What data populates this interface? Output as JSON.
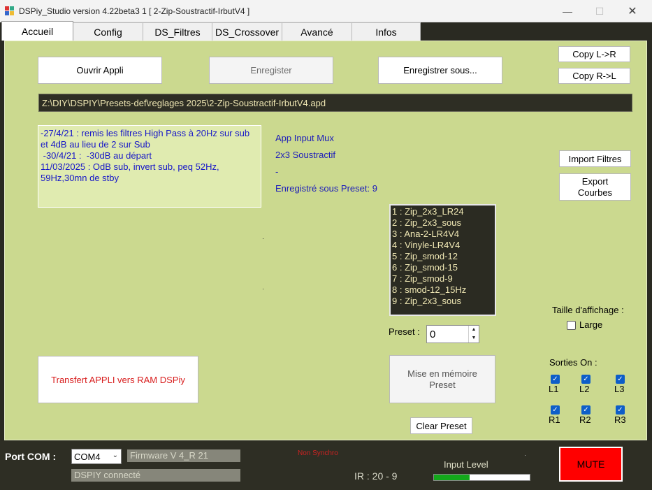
{
  "window": {
    "title": "DSPiy_Studio version 4.22beta3 1 [ 2-Zip-Soustractif-IrbutV4 ]",
    "minimize_icon": "minimize-icon",
    "maximize_icon": "maximize-icon",
    "close_icon": "close-icon"
  },
  "tabs": [
    {
      "label": "Accueil"
    },
    {
      "label": "Config"
    },
    {
      "label": "DS_Filtres"
    },
    {
      "label": "DS_Crossover"
    },
    {
      "label": "Avancé"
    },
    {
      "label": "Infos"
    }
  ],
  "toolbar": {
    "open_label": "Ouvrir Appli",
    "save_label": "Enregister",
    "save_as_label": "Enregistrer sous...",
    "copy_lr_label": "Copy L->R",
    "copy_rl_label": "Copy R->L"
  },
  "file_path": "Z:\\DIY\\DSPIY\\Presets-def\\reglages 2025\\2-Zip-Soustractif-IrbutV4.apd",
  "notes": {
    "lines": [
      "-27/4/21 : remis les filtres High Pass à 20Hz sur sub et 4dB au lieu de 2 sur Sub",
      " -30/4/21 :  -30dB au départ",
      "11/03/2025 : OdB sub, invert sub, peq 52Hz, 59Hz,30mn de stby"
    ]
  },
  "app_info": {
    "line1": "App Input Mux",
    "line2": "2x3 Soustractif",
    "line3": "-",
    "line4": "Enregistré sous Preset: 9"
  },
  "side_buttons": {
    "import_label": "Import Filtres",
    "export_label": "Export\nCourbes"
  },
  "presets": [
    "1 : Zip_2x3_LR24",
    "2 : Zip_2x3_sous",
    "3 : Ana-2-LR4V4",
    "4 : Vinyle-LR4V4",
    "5 : Zip_smod-12",
    "6 : Zip_smod-15",
    "7 : Zip_smod-9",
    "8 : smod-12_15Hz",
    "9 : Zip_2x3_sous"
  ],
  "preset_selector": {
    "label": "Preset :",
    "value": "0",
    "up_icon": "arrow-up-icon",
    "down_icon": "arrow-down-icon"
  },
  "display": {
    "size_label": "Taille d'affichage :",
    "large_label": "Large",
    "large_checked": false
  },
  "actions": {
    "transfer_label": "Transfert APPLI vers RAM DSPiy",
    "memorize_label": "Mise en mémoire\nPreset",
    "clear_label": "Clear Preset"
  },
  "outputs": {
    "title": "Sorties On :",
    "items": [
      {
        "label": "L1",
        "checked": true
      },
      {
        "label": "L2",
        "checked": true
      },
      {
        "label": "L3",
        "checked": true
      },
      {
        "label": "R1",
        "checked": true
      },
      {
        "label": "R2",
        "checked": true
      },
      {
        "label": "R3",
        "checked": true
      }
    ]
  },
  "status": {
    "port_label": "Port COM :",
    "port_value": "COM4",
    "firmware": "Firmware V 4_R 21",
    "connection": "DSPIY connecté",
    "sync": "Non Synchro",
    "ir": "IR : 20 - 9",
    "input_level_label": "Input Level",
    "input_level_fraction": 0.37,
    "mute_label": "MUTE"
  },
  "colors": {
    "panel": "#cbd98f",
    "accent_blue": "#1d1dba",
    "mute_red": "#ff0000",
    "meter_green": "#13a81b"
  }
}
